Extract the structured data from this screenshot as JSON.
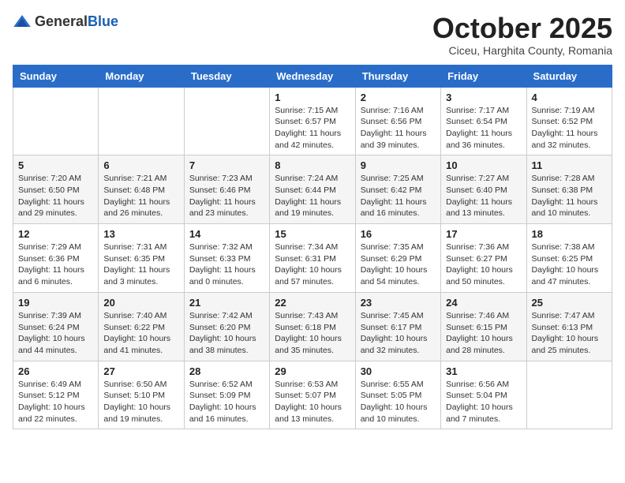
{
  "header": {
    "logo": {
      "general": "General",
      "blue": "Blue"
    },
    "month": "October 2025",
    "location": "Ciceu, Harghita County, Romania"
  },
  "weekdays": [
    "Sunday",
    "Monday",
    "Tuesday",
    "Wednesday",
    "Thursday",
    "Friday",
    "Saturday"
  ],
  "weeks": [
    [
      {
        "day": "",
        "info": ""
      },
      {
        "day": "",
        "info": ""
      },
      {
        "day": "",
        "info": ""
      },
      {
        "day": "1",
        "info": "Sunrise: 7:15 AM\nSunset: 6:57 PM\nDaylight: 11 hours and 42 minutes."
      },
      {
        "day": "2",
        "info": "Sunrise: 7:16 AM\nSunset: 6:56 PM\nDaylight: 11 hours and 39 minutes."
      },
      {
        "day": "3",
        "info": "Sunrise: 7:17 AM\nSunset: 6:54 PM\nDaylight: 11 hours and 36 minutes."
      },
      {
        "day": "4",
        "info": "Sunrise: 7:19 AM\nSunset: 6:52 PM\nDaylight: 11 hours and 32 minutes."
      }
    ],
    [
      {
        "day": "5",
        "info": "Sunrise: 7:20 AM\nSunset: 6:50 PM\nDaylight: 11 hours and 29 minutes."
      },
      {
        "day": "6",
        "info": "Sunrise: 7:21 AM\nSunset: 6:48 PM\nDaylight: 11 hours and 26 minutes."
      },
      {
        "day": "7",
        "info": "Sunrise: 7:23 AM\nSunset: 6:46 PM\nDaylight: 11 hours and 23 minutes."
      },
      {
        "day": "8",
        "info": "Sunrise: 7:24 AM\nSunset: 6:44 PM\nDaylight: 11 hours and 19 minutes."
      },
      {
        "day": "9",
        "info": "Sunrise: 7:25 AM\nSunset: 6:42 PM\nDaylight: 11 hours and 16 minutes."
      },
      {
        "day": "10",
        "info": "Sunrise: 7:27 AM\nSunset: 6:40 PM\nDaylight: 11 hours and 13 minutes."
      },
      {
        "day": "11",
        "info": "Sunrise: 7:28 AM\nSunset: 6:38 PM\nDaylight: 11 hours and 10 minutes."
      }
    ],
    [
      {
        "day": "12",
        "info": "Sunrise: 7:29 AM\nSunset: 6:36 PM\nDaylight: 11 hours and 6 minutes."
      },
      {
        "day": "13",
        "info": "Sunrise: 7:31 AM\nSunset: 6:35 PM\nDaylight: 11 hours and 3 minutes."
      },
      {
        "day": "14",
        "info": "Sunrise: 7:32 AM\nSunset: 6:33 PM\nDaylight: 11 hours and 0 minutes."
      },
      {
        "day": "15",
        "info": "Sunrise: 7:34 AM\nSunset: 6:31 PM\nDaylight: 10 hours and 57 minutes."
      },
      {
        "day": "16",
        "info": "Sunrise: 7:35 AM\nSunset: 6:29 PM\nDaylight: 10 hours and 54 minutes."
      },
      {
        "day": "17",
        "info": "Sunrise: 7:36 AM\nSunset: 6:27 PM\nDaylight: 10 hours and 50 minutes."
      },
      {
        "day": "18",
        "info": "Sunrise: 7:38 AM\nSunset: 6:25 PM\nDaylight: 10 hours and 47 minutes."
      }
    ],
    [
      {
        "day": "19",
        "info": "Sunrise: 7:39 AM\nSunset: 6:24 PM\nDaylight: 10 hours and 44 minutes."
      },
      {
        "day": "20",
        "info": "Sunrise: 7:40 AM\nSunset: 6:22 PM\nDaylight: 10 hours and 41 minutes."
      },
      {
        "day": "21",
        "info": "Sunrise: 7:42 AM\nSunset: 6:20 PM\nDaylight: 10 hours and 38 minutes."
      },
      {
        "day": "22",
        "info": "Sunrise: 7:43 AM\nSunset: 6:18 PM\nDaylight: 10 hours and 35 minutes."
      },
      {
        "day": "23",
        "info": "Sunrise: 7:45 AM\nSunset: 6:17 PM\nDaylight: 10 hours and 32 minutes."
      },
      {
        "day": "24",
        "info": "Sunrise: 7:46 AM\nSunset: 6:15 PM\nDaylight: 10 hours and 28 minutes."
      },
      {
        "day": "25",
        "info": "Sunrise: 7:47 AM\nSunset: 6:13 PM\nDaylight: 10 hours and 25 minutes."
      }
    ],
    [
      {
        "day": "26",
        "info": "Sunrise: 6:49 AM\nSunset: 5:12 PM\nDaylight: 10 hours and 22 minutes."
      },
      {
        "day": "27",
        "info": "Sunrise: 6:50 AM\nSunset: 5:10 PM\nDaylight: 10 hours and 19 minutes."
      },
      {
        "day": "28",
        "info": "Sunrise: 6:52 AM\nSunset: 5:09 PM\nDaylight: 10 hours and 16 minutes."
      },
      {
        "day": "29",
        "info": "Sunrise: 6:53 AM\nSunset: 5:07 PM\nDaylight: 10 hours and 13 minutes."
      },
      {
        "day": "30",
        "info": "Sunrise: 6:55 AM\nSunset: 5:05 PM\nDaylight: 10 hours and 10 minutes."
      },
      {
        "day": "31",
        "info": "Sunrise: 6:56 AM\nSunset: 5:04 PM\nDaylight: 10 hours and 7 minutes."
      },
      {
        "day": "",
        "info": ""
      }
    ]
  ]
}
